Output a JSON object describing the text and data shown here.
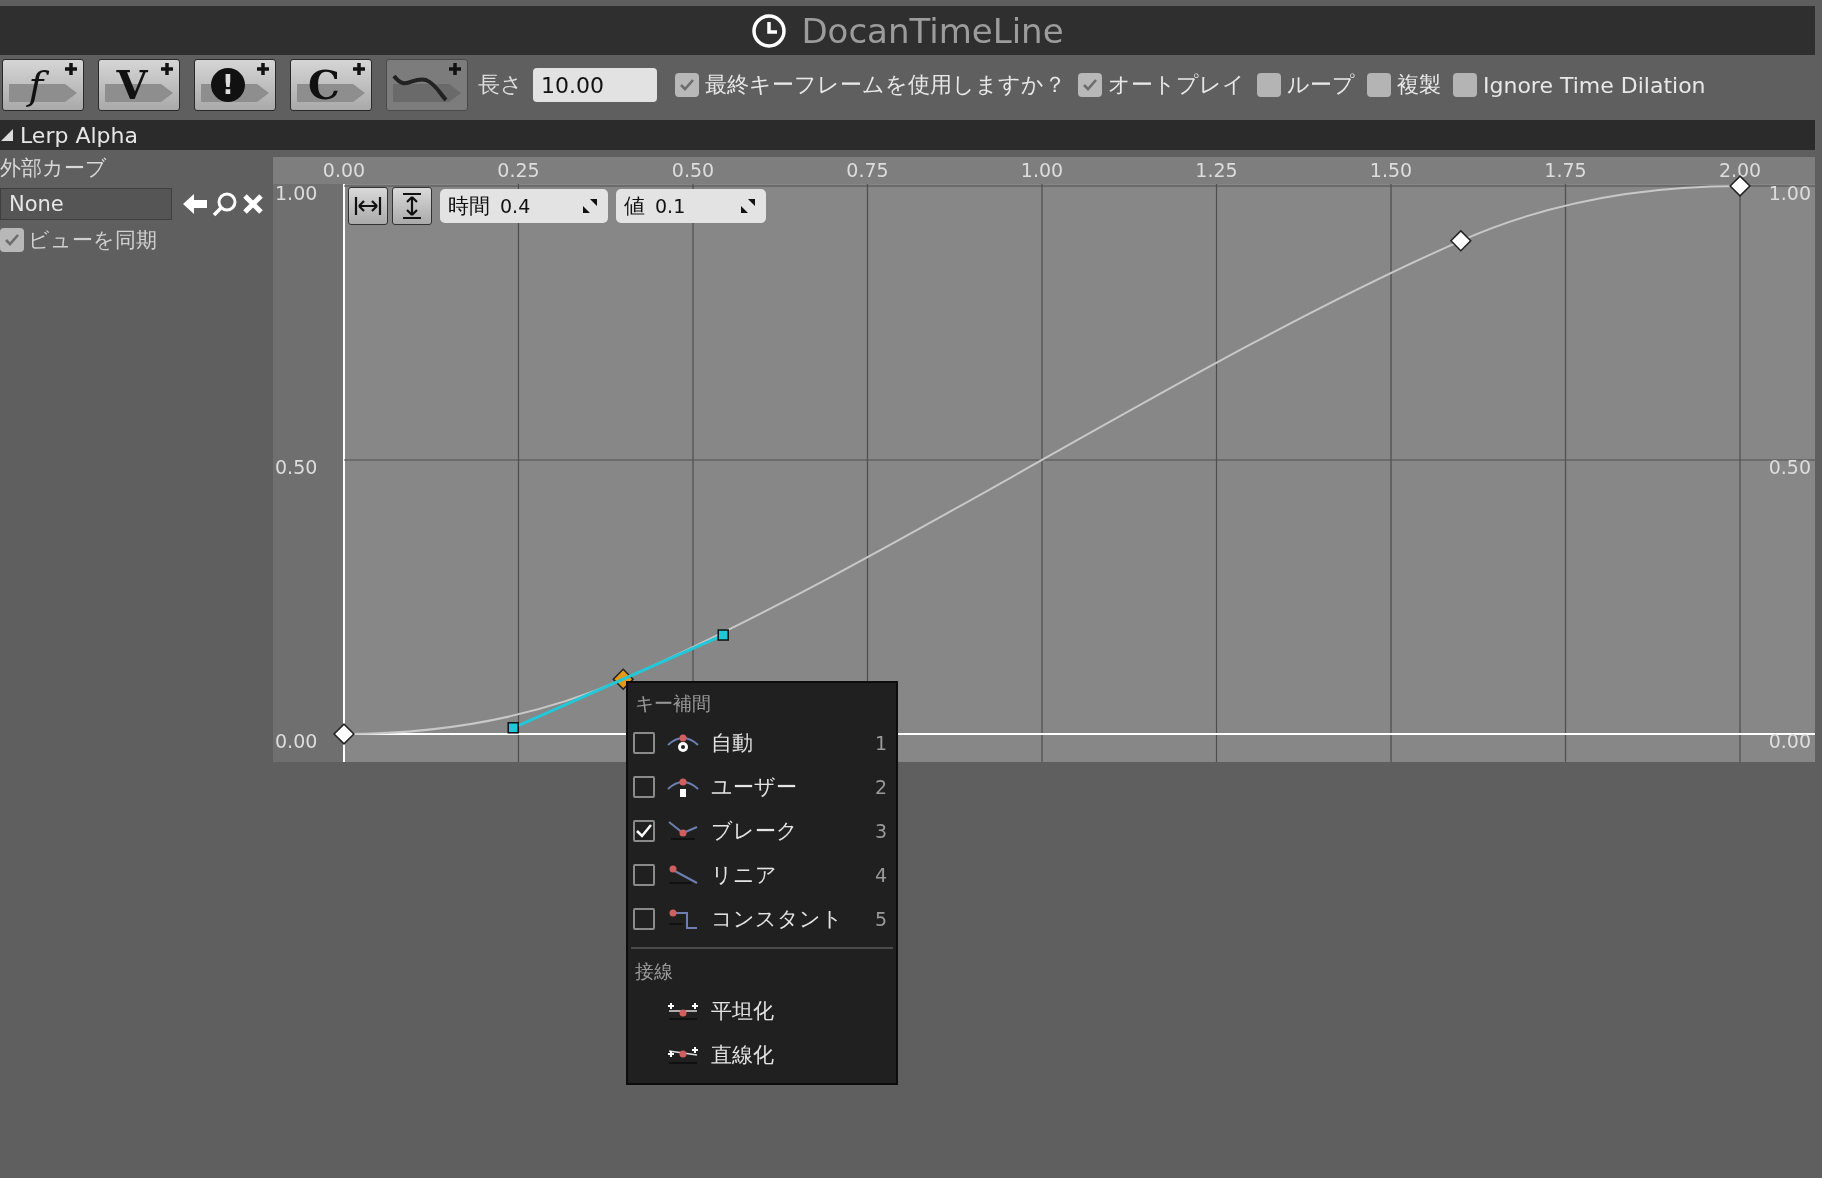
{
  "window": {
    "title": "DocanTimeLine"
  },
  "toolbar": {
    "buttons": [
      {
        "kind": "glyph",
        "glyph": "f",
        "disabled": false
      },
      {
        "kind": "glyph",
        "glyph": "V",
        "disabled": false
      },
      {
        "kind": "circle-glyph",
        "glyph": "!",
        "disabled": false
      },
      {
        "kind": "glyph",
        "glyph": "C",
        "disabled": false
      },
      {
        "kind": "curve",
        "disabled": true
      }
    ],
    "length": {
      "label": "長さ",
      "value": "10.00"
    },
    "options": [
      {
        "label": "最終キーフレームを使用しますか？",
        "checked": true
      },
      {
        "label": "オートプレイ",
        "checked": true
      },
      {
        "label": "ループ",
        "checked": false
      },
      {
        "label": "複製",
        "checked": false
      },
      {
        "label": "Ignore Time Dilation",
        "checked": false
      }
    ]
  },
  "track": {
    "name": "Lerp Alpha",
    "expanded": true,
    "external_curve": {
      "label": "外部カーブ",
      "value": "None"
    },
    "sync_view": {
      "label": "ビューを同期",
      "checked": true
    }
  },
  "graph": {
    "key_time": {
      "label": "時間",
      "value": "0.4"
    },
    "key_value": {
      "label": "値",
      "value": "0.1"
    },
    "right_axis_labels": [
      "1.00",
      "0.50",
      "0.00"
    ],
    "keys": [
      {
        "selected": false
      },
      {
        "selected": true
      },
      {
        "selected": false
      },
      {
        "selected": false
      }
    ],
    "chart_data": {
      "type": "line",
      "x": [
        0,
        0.4,
        1.6,
        2.0
      ],
      "series": [
        {
          "color": "#c8c8c8",
          "marker": "diamond",
          "values": [
            0,
            0.1,
            0.9,
            1.0
          ]
        }
      ],
      "grid": true,
      "xlim": [
        -0.1017,
        2.1074
      ],
      "ylim": [
        -0.0511,
        1.0529
      ],
      "xticks": [
        {
          "value": 0,
          "label": "0.00"
        },
        {
          "value": 0.25,
          "label": "0.25"
        },
        {
          "value": 0.5,
          "label": "0.50"
        },
        {
          "value": 0.75,
          "label": "0.75"
        },
        {
          "value": 1,
          "label": "1.00"
        },
        {
          "value": 1.25,
          "label": "1.25"
        },
        {
          "value": 1.5,
          "label": "1.50"
        },
        {
          "value": 1.75,
          "label": "1.75"
        },
        {
          "value": 2,
          "label": "2.00"
        }
      ],
      "yticks": [
        {
          "value": 0,
          "label": "0.00"
        },
        {
          "value": 0.5,
          "label": "0.50"
        },
        {
          "value": 1,
          "label": "1.00"
        }
      ]
    }
  },
  "context_menu": {
    "sections": [
      {
        "title": "キー補間",
        "items": [
          {
            "kind": "check",
            "label": "自動",
            "shortcut": "1",
            "checked": false
          },
          {
            "kind": "check",
            "label": "ユーザー",
            "shortcut": "2",
            "checked": false
          },
          {
            "kind": "check",
            "label": "ブレーク",
            "shortcut": "3",
            "checked": true
          },
          {
            "kind": "check",
            "label": "リニア",
            "shortcut": "4",
            "checked": false
          },
          {
            "kind": "check",
            "label": "コンスタント",
            "shortcut": "5",
            "checked": false
          }
        ]
      },
      {
        "title": "接線",
        "items": [
          {
            "kind": "action",
            "label": "平坦化"
          },
          {
            "kind": "action",
            "label": "直線化"
          }
        ]
      }
    ]
  }
}
